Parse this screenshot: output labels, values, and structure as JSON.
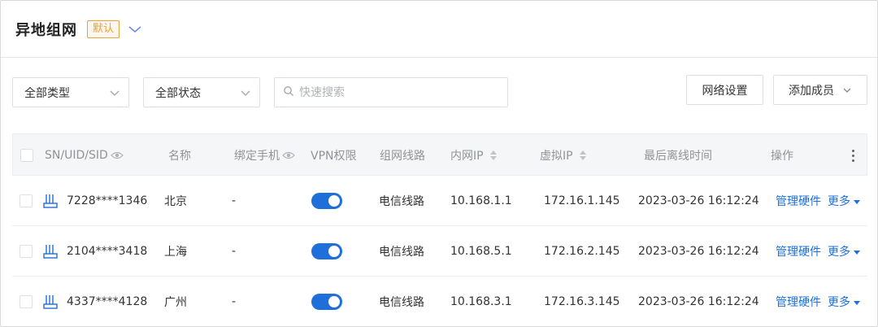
{
  "header": {
    "title": "异地组网",
    "badge": "默认"
  },
  "toolbar": {
    "type_select": "全部类型",
    "status_select": "全部状态",
    "search_placeholder": "快速搜索",
    "network_settings": "网络设置",
    "add_member": "添加成员"
  },
  "table": {
    "columns": {
      "id": "SN/UID/SID",
      "name": "名称",
      "bind_phone": "绑定手机",
      "vpn": "VPN权限",
      "line": "组网线路",
      "lan_ip": "内网IP",
      "virtual_ip": "虚拟IP",
      "last_offline": "最后离线时间",
      "actions": "操作"
    },
    "rows": [
      {
        "id": "7228****1346",
        "name": "北京",
        "phone": "-",
        "vpn": true,
        "line": "电信线路",
        "lan_ip": "10.168.1.1",
        "virtual_ip": "172.16.1.145",
        "last_offline": "2023-03-26 16:12:24",
        "manage": "管理硬件",
        "more": "更多"
      },
      {
        "id": "2104****3418",
        "name": "上海",
        "phone": "-",
        "vpn": true,
        "line": "电信线路",
        "lan_ip": "10.168.5.1",
        "virtual_ip": "172.16.2.145",
        "last_offline": "2023-03-26 16:12:24",
        "manage": "管理硬件",
        "more": "更多"
      },
      {
        "id": "4337****4128",
        "name": "广州",
        "phone": "-",
        "vpn": true,
        "line": "电信线路",
        "lan_ip": "10.168.3.1",
        "virtual_ip": "172.16.3.145",
        "last_offline": "2023-03-26 16:12:24",
        "manage": "管理硬件",
        "more": "更多"
      }
    ]
  },
  "colors": {
    "accent": "#1e6fd9",
    "badge": "#e6a23c"
  }
}
